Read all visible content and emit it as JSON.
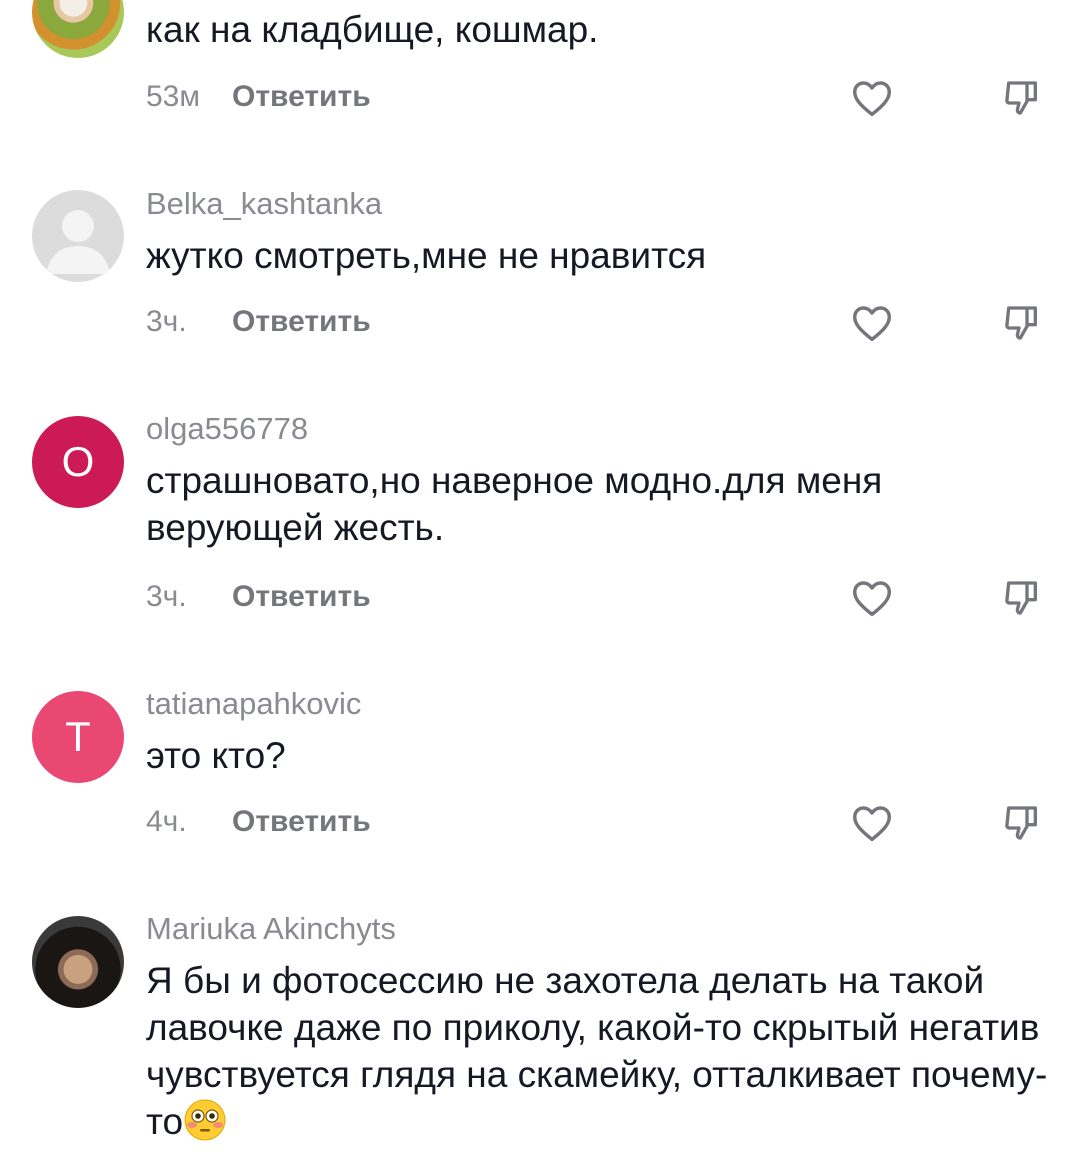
{
  "comments": [
    {
      "avatar_letter": "",
      "username": "",
      "text": "как на кладбище, кошмар.",
      "time": "53м",
      "reply_label": "Ответить"
    },
    {
      "avatar_letter": "",
      "username": "Belka_kashtanka",
      "text": "жутко смотреть,мне не нравится",
      "time": "3ч.",
      "reply_label": "Ответить"
    },
    {
      "avatar_letter": "O",
      "username": "olga556778",
      "text": "страшновато,но наверное модно.для меня верующей жесть.",
      "time": "3ч.",
      "reply_label": "Ответить"
    },
    {
      "avatar_letter": "T",
      "username": "tatianapahkovic",
      "text": "это кто?",
      "time": "4ч.",
      "reply_label": "Ответить"
    },
    {
      "avatar_letter": "",
      "username": "Mariuka Akinchyts",
      "text": "Я бы и фотосессию не захотела делать на такой лавочке даже по приколу, какой-то скрытый негатив чувствуется глядя на скамейку, отталкивает почему-то",
      "emoji": "flushed-face-emoji"
    }
  ],
  "icons": {
    "like": "heart-outline-icon",
    "dislike": "thumbs-down-outline-icon"
  },
  "colors": {
    "text": "#161823",
    "secondary": "#8a8b91",
    "avatar_o": "#cc1a57",
    "avatar_t": "#e94873"
  }
}
